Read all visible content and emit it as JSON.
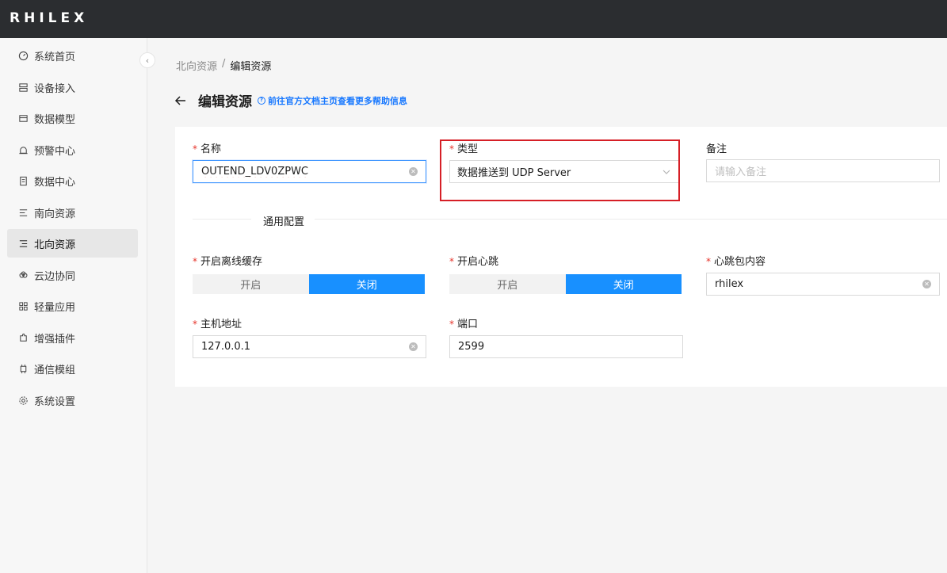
{
  "app": {
    "logo": "RHILEX"
  },
  "sidebar": {
    "collapse_icon": "chevron-left-icon",
    "items": [
      {
        "label": "系统首页",
        "icon": "dashboard-icon"
      },
      {
        "label": "设备接入",
        "icon": "device-icon"
      },
      {
        "label": "数据模型",
        "icon": "model-icon"
      },
      {
        "label": "预警中心",
        "icon": "alarm-icon"
      },
      {
        "label": "数据中心",
        "icon": "database-icon"
      },
      {
        "label": "南向资源",
        "icon": "south-icon"
      },
      {
        "label": "北向资源",
        "icon": "north-icon",
        "active": true
      },
      {
        "label": "云边协同",
        "icon": "cloud-icon"
      },
      {
        "label": "轻量应用",
        "icon": "apps-icon"
      },
      {
        "label": "增强插件",
        "icon": "plugin-icon"
      },
      {
        "label": "通信模组",
        "icon": "chip-icon"
      },
      {
        "label": "系统设置",
        "icon": "settings-icon"
      }
    ]
  },
  "breadcrumb": {
    "parent": "北向资源",
    "separator": "/",
    "current": "编辑资源"
  },
  "header": {
    "title": "编辑资源",
    "help_text": "前往官方文档主页查看更多帮助信息"
  },
  "form": {
    "name": {
      "required_mark": "*",
      "label": "名称",
      "value": "OUTEND_LDV0ZPWC"
    },
    "type": {
      "required_mark": "*",
      "label": "类型",
      "value": "数据推送到 UDP Server"
    },
    "remark": {
      "label": "备注",
      "placeholder": "请输入备注",
      "value": ""
    },
    "section_title": "通用配置",
    "offline_cache": {
      "required_mark": "*",
      "label": "开启离线缓存",
      "options": [
        "开启",
        "关闭"
      ],
      "selected": "关闭"
    },
    "heartbeat": {
      "required_mark": "*",
      "label": "开启心跳",
      "options": [
        "开启",
        "关闭"
      ],
      "selected": "关闭"
    },
    "heartbeat_content": {
      "required_mark": "*",
      "label": "心跳包内容",
      "value": "rhilex"
    },
    "host": {
      "required_mark": "*",
      "label": "主机地址",
      "value": "127.0.0.1"
    },
    "port": {
      "required_mark": "*",
      "label": "端口",
      "value": "2599"
    }
  },
  "colors": {
    "accent": "#1890ff",
    "topbar": "#2b2d30",
    "highlight": "#d61f26",
    "required": "#e6332a"
  }
}
